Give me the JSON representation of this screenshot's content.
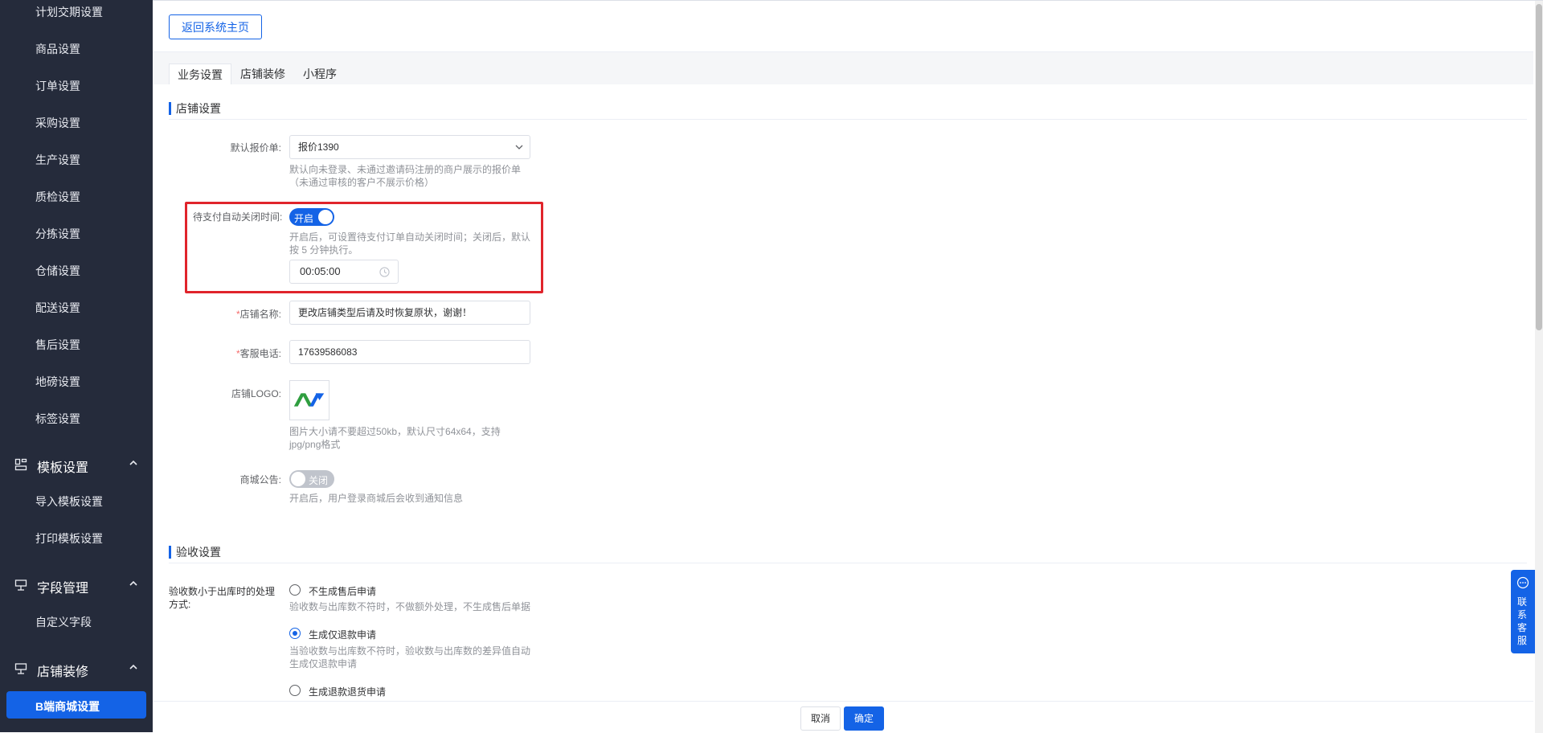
{
  "sidebar": {
    "sub_items": [
      "计划交期设置",
      "商品设置",
      "订单设置",
      "采购设置",
      "生产设置",
      "质检设置",
      "分拣设置",
      "仓储设置",
      "配送设置",
      "售后设置",
      "地磅设置",
      "标签设置"
    ],
    "groups": [
      {
        "label": "模板设置",
        "icon": "template-icon",
        "items": [
          "导入模板设置",
          "打印模板设置"
        ]
      },
      {
        "label": "字段管理",
        "icon": "field-icon",
        "items": [
          "自定义字段"
        ]
      },
      {
        "label": "店铺装修",
        "icon": "decorate-icon",
        "items": [
          "B端商城设置"
        ]
      }
    ],
    "active_item": "B端商城设置"
  },
  "topbar": {
    "back_label": "返回系统主页"
  },
  "tabs": [
    {
      "label": "业务设置",
      "active": true
    },
    {
      "label": "店铺装修",
      "active": false
    },
    {
      "label": "小程序",
      "active": false
    }
  ],
  "shop_section": {
    "title": "店铺设置",
    "default_quote": {
      "label": "默认报价单:",
      "value": "报价1390",
      "hint1": "默认向未登录、未通过邀请码注册的商户展示的报价单",
      "hint2": "（未通过审核的客户不展示价格）"
    },
    "auto_close": {
      "label": "待支付自动关闭时间:",
      "toggle": "开启",
      "hint1": "开启后，可设置待支付订单自动关闭时间；关闭后，默认",
      "hint2": "按 5 分钟执行。",
      "time_value": "00:05:00"
    },
    "shop_name": {
      "label": "店铺名称:",
      "value": "更改店铺类型后请及时恢复原状，谢谢！"
    },
    "phone": {
      "label": "客服电话:",
      "value": "17639586083"
    },
    "logo": {
      "label": "店铺LOGO:",
      "hint1": "图片大小请不要超过50kb，默认尺寸64x64，支持",
      "hint2": "jpg/png格式"
    },
    "notice": {
      "label": "商城公告:",
      "toggle": "关闭",
      "hint": "开启后，用户登录商城后会收到通知信息"
    }
  },
  "accept_section": {
    "title": "验收设置",
    "label_line1": "验收数小于出库时的处理",
    "label_line2": "方式:",
    "options": [
      {
        "label": "不生成售后申请",
        "hint1": "验收数与出库数不符时，不做额外处理，不生成售后单据",
        "hint2": "",
        "checked": false
      },
      {
        "label": "生成仅退款申请",
        "hint1": "当验收数与出库数不符时，验收数与出库数的差异值自动",
        "hint2": "生成仅退款申请",
        "checked": true
      },
      {
        "label": "生成退款退货申请",
        "hint1": "",
        "hint2": "",
        "checked": false
      }
    ]
  },
  "footer": {
    "cancel": "取消",
    "ok": "确定"
  },
  "service": {
    "label": "联系客服"
  },
  "colors": {
    "primary": "#1463e6",
    "sidebar_bg": "#252b3b",
    "highlight": "#e0242b"
  }
}
